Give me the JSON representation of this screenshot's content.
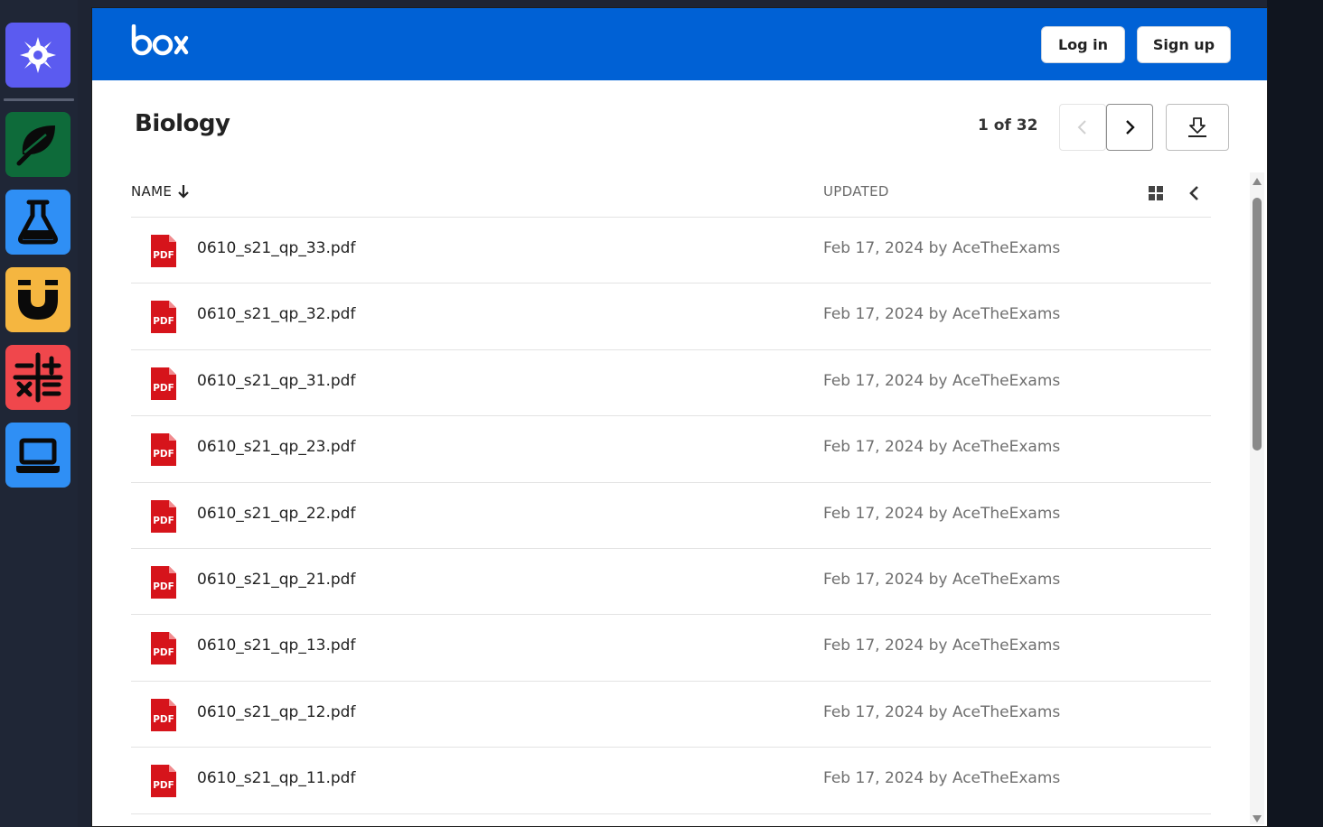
{
  "brand": {
    "logo_text": "box",
    "primary_color": "#0061d5"
  },
  "header": {
    "login_label": "Log in",
    "signup_label": "Sign up"
  },
  "folder": {
    "title": "Biology",
    "pager": "1 of 32"
  },
  "columns": {
    "name": "NAME",
    "updated": "UPDATED"
  },
  "sidebar_apps": [
    {
      "icon": "settings-gear-icon",
      "color": "#5b5bf0"
    },
    {
      "icon": "leaf-icon",
      "color": "#0e6b3a"
    },
    {
      "icon": "flask-icon",
      "color": "#2f8ff5"
    },
    {
      "icon": "magnet-icon",
      "color": "#f5b640"
    },
    {
      "icon": "calculator-icon",
      "color": "#f0474c"
    },
    {
      "icon": "laptop-icon",
      "color": "#2f8ff5"
    }
  ],
  "files": [
    {
      "name": "0610_s21_qp_33.pdf",
      "updated": "Feb 17, 2024 by AceTheExams"
    },
    {
      "name": "0610_s21_qp_32.pdf",
      "updated": "Feb 17, 2024 by AceTheExams"
    },
    {
      "name": "0610_s21_qp_31.pdf",
      "updated": "Feb 17, 2024 by AceTheExams"
    },
    {
      "name": "0610_s21_qp_23.pdf",
      "updated": "Feb 17, 2024 by AceTheExams"
    },
    {
      "name": "0610_s21_qp_22.pdf",
      "updated": "Feb 17, 2024 by AceTheExams"
    },
    {
      "name": "0610_s21_qp_21.pdf",
      "updated": "Feb 17, 2024 by AceTheExams"
    },
    {
      "name": "0610_s21_qp_13.pdf",
      "updated": "Feb 17, 2024 by AceTheExams"
    },
    {
      "name": "0610_s21_qp_12.pdf",
      "updated": "Feb 17, 2024 by AceTheExams"
    },
    {
      "name": "0610_s21_qp_11.pdf",
      "updated": "Feb 17, 2024 by AceTheExams"
    }
  ],
  "file_badge": "PDF"
}
